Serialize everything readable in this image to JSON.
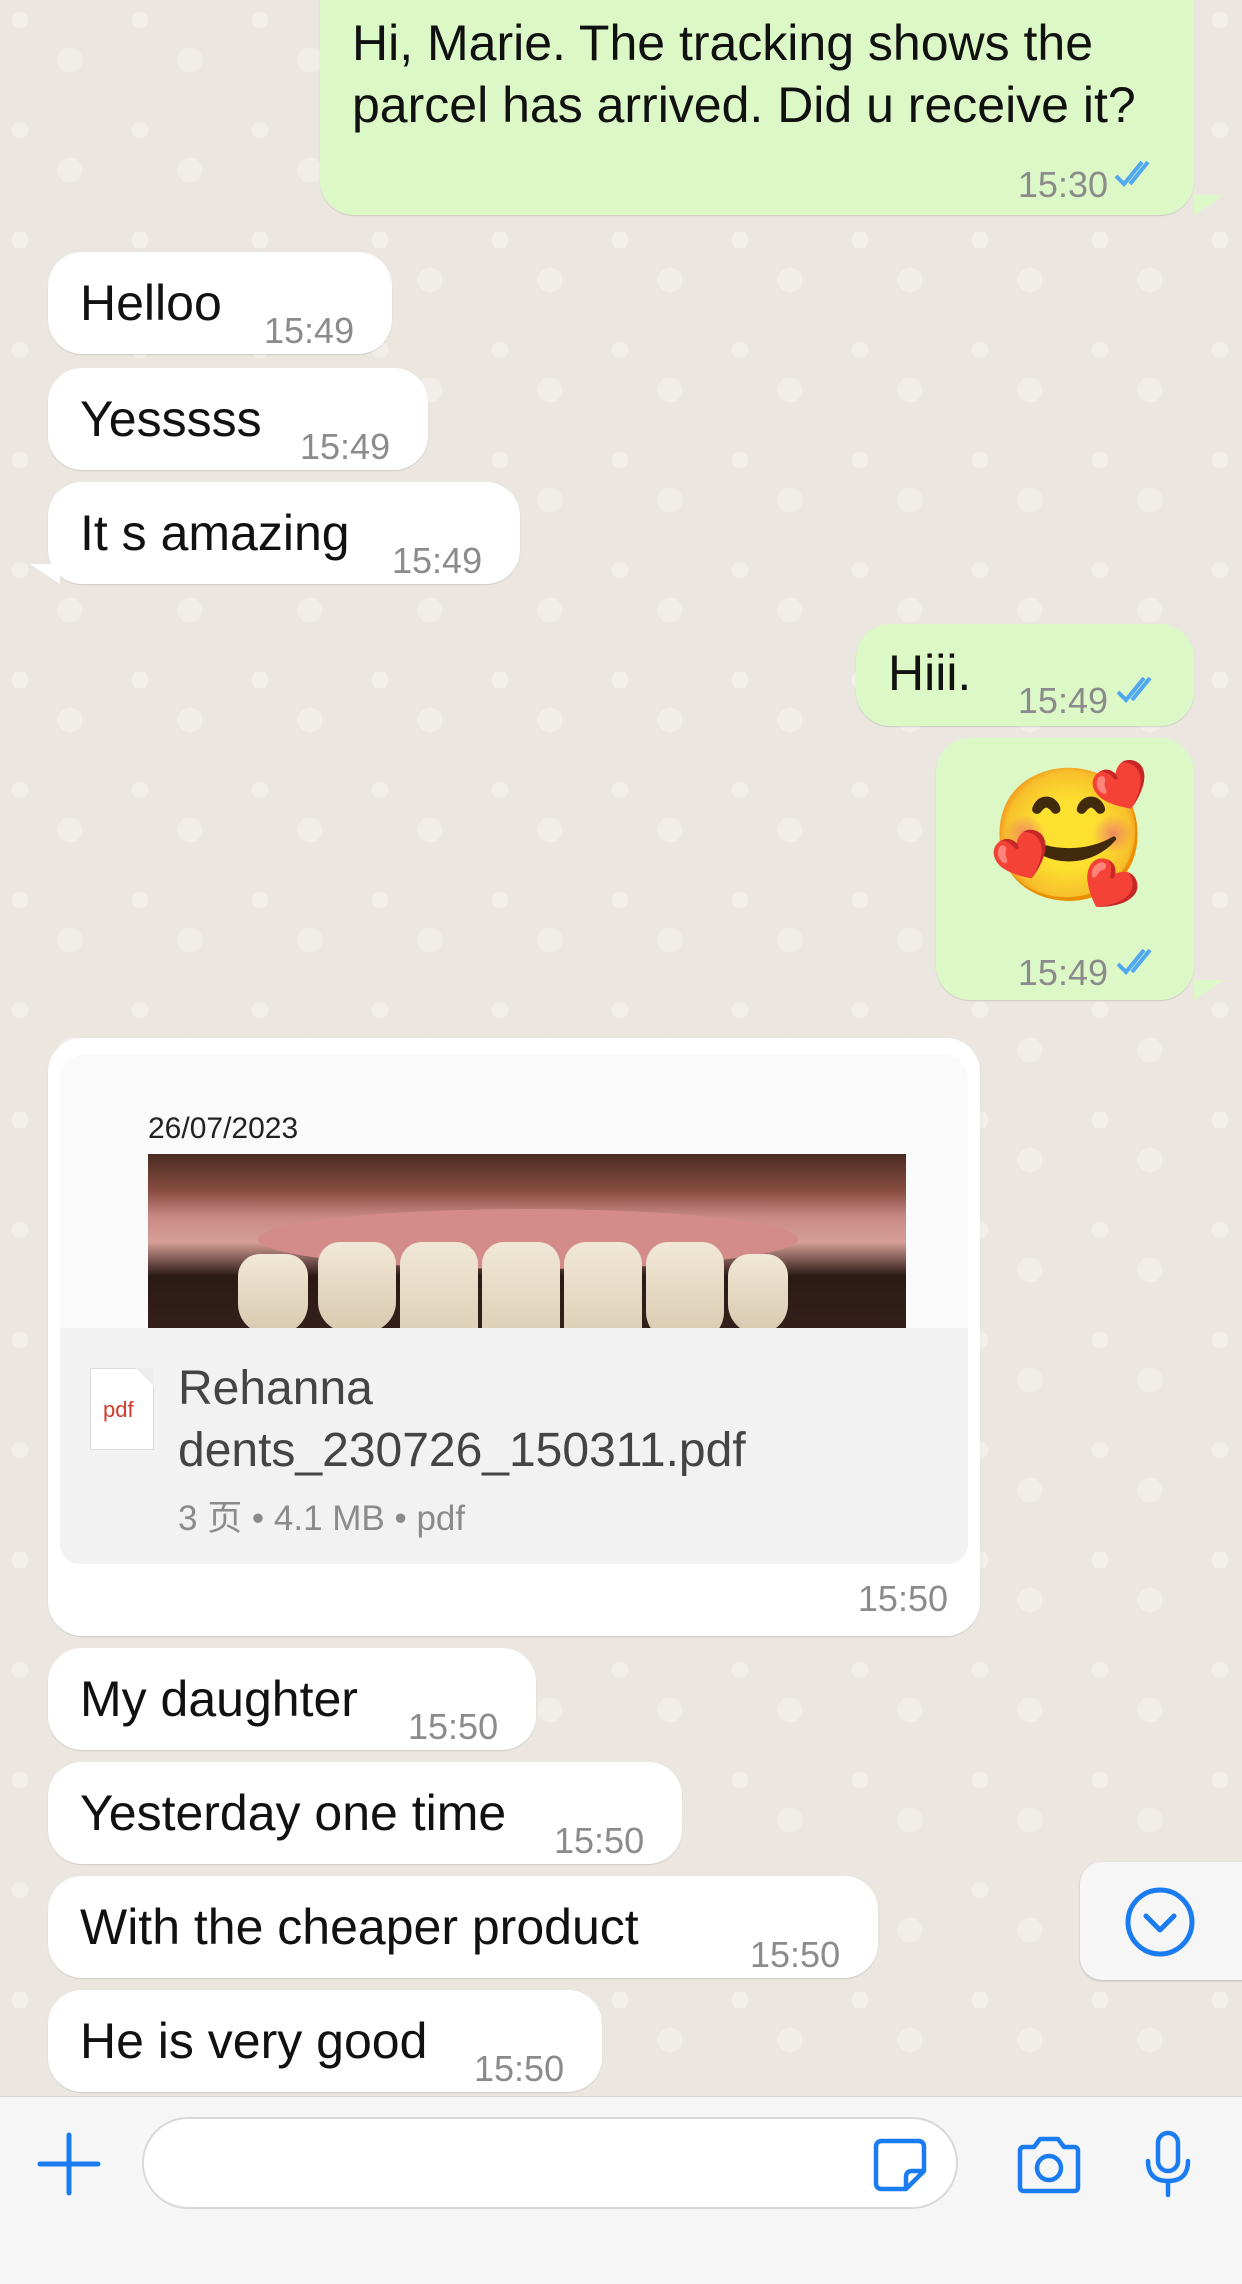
{
  "messages": [
    {
      "id": "m1",
      "direction": "outgoing",
      "text_line1": "Hi, Marie. The tracking shows the",
      "text_line2": "parcel has arrived. Did u receive it?",
      "time": "15:30",
      "read": true
    },
    {
      "id": "m2",
      "direction": "incoming",
      "text": "Helloo",
      "time": "15:49"
    },
    {
      "id": "m3",
      "direction": "incoming",
      "text": "Yesssss",
      "time": "15:49"
    },
    {
      "id": "m4",
      "direction": "incoming",
      "text": "It s amazing",
      "time": "15:49"
    },
    {
      "id": "m5",
      "direction": "outgoing",
      "text": "Hiii.",
      "time": "15:49",
      "read": true
    },
    {
      "id": "m6",
      "direction": "outgoing",
      "emoji": "🥰",
      "time": "15:49",
      "read": true
    },
    {
      "id": "m8",
      "direction": "incoming",
      "text": "My daughter",
      "time": "15:50"
    },
    {
      "id": "m9",
      "direction": "incoming",
      "text": "Yesterday one time",
      "time": "15:50"
    },
    {
      "id": "m10",
      "direction": "incoming",
      "text": "With the cheaper product",
      "time": "15:50"
    },
    {
      "id": "m11",
      "direction": "incoming",
      "text": "He is very good",
      "time": "15:50"
    }
  ],
  "document": {
    "preview_date": "26/07/2023",
    "file_name_line1": "Rehanna",
    "file_name_line2": "dents_230726_150311.pdf",
    "meta": "3 页 • 4.1 MB • pdf",
    "icon_label": "pdf",
    "time": "15:50"
  },
  "colors": {
    "outgoing_bubble": "#dcf8c6",
    "incoming_bubble": "#ffffff",
    "accent_blue": "#1a7cf0",
    "read_ticks": "#4fa8f0"
  },
  "icons": {
    "attach": "plus-icon",
    "sticker": "sticker-icon",
    "camera": "camera-icon",
    "microphone": "microphone-icon",
    "scroll": "chevron-down-circle-icon"
  }
}
